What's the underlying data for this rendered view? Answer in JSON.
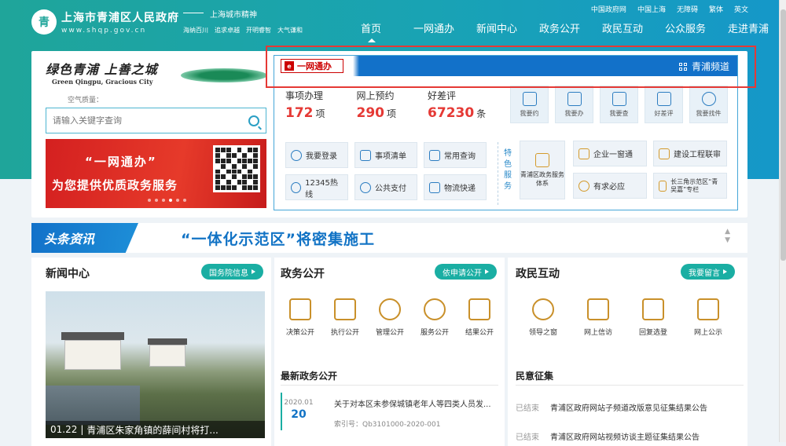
{
  "site": {
    "title": "上海市青浦区人民政府",
    "url": "www.shqp.gov.cn",
    "emblem": "青"
  },
  "spirit": {
    "title": "上海城市精神",
    "words": [
      "海纳百川",
      "追求卓越",
      "开明睿智",
      "大气谦和"
    ]
  },
  "util_links": [
    "中国政府网",
    "中国上海",
    "无障碍",
    "繁体",
    "英文"
  ],
  "nav": [
    "首页",
    "一网通办",
    "新闻中心",
    "政务公开",
    "政民互动",
    "公众服务",
    "走进青浦"
  ],
  "slogan": {
    "cn": "绿色青浦  上善之城",
    "en": "Green Qingpu, Gracious City"
  },
  "air_label": "空气质量：",
  "search": {
    "placeholder": "请输入关键字查询"
  },
  "banner": {
    "line1": "“一网通办”",
    "line2": "为您提供优质政务服务"
  },
  "ywtb": {
    "logo": "一网通办",
    "channel": "青浦频道",
    "stats": [
      {
        "label": "事项办理",
        "value": "172",
        "unit": "项"
      },
      {
        "label": "网上预约",
        "value": "290",
        "unit": "项"
      },
      {
        "label": "好差评",
        "value": "67230",
        "unit": "条"
      }
    ],
    "quick": [
      "我要约",
      "我要办",
      "我要查",
      "好差评",
      "我要找件"
    ],
    "services": [
      "我要登录",
      "事项清单",
      "常用查询",
      "12345热线",
      "公共支付",
      "物流快递"
    ],
    "feature_label": "特色服务",
    "feature_big": "青浦区政务服务体系",
    "features": [
      "企业一窗通",
      "建设工程联审",
      "有求必应",
      "长三角示范区“青吴嘉”专栏"
    ]
  },
  "headline": {
    "tag": "头条资讯",
    "text": "“一体化示范区”将密集施工"
  },
  "news_center": {
    "title": "新闻中心",
    "button": "国务院信息",
    "caption_date": "01.22",
    "caption_text": "青浦区朱家角镇的薛间村将打..."
  },
  "gov_open": {
    "title": "政务公开",
    "button": "依申请公开",
    "icons": [
      "决策公开",
      "执行公开",
      "管理公开",
      "服务公开",
      "结果公开"
    ],
    "latest_title": "最新政务公开",
    "item": {
      "year": "2020.01",
      "day": "20",
      "title": "关于对本区未参保城镇老年人等四类人员发...",
      "index": "索引号：Qb3101000-2020-001"
    }
  },
  "interaction": {
    "title": "政民互动",
    "button": "我要留言",
    "icons": [
      "领导之窗",
      "网上信访",
      "回复选登",
      "网上公示"
    ],
    "collect_title": "民意征集",
    "items": [
      {
        "status": "已结束",
        "text": "青浦区政府网站子频道改版意见征集结果公告"
      },
      {
        "status": "已结束",
        "text": "青浦区政府网站视频访谈主题征集结果公告"
      }
    ]
  },
  "colors": {
    "teal": "#1fa59a",
    "blue": "#1271c9",
    "red": "#e53935",
    "accent": "#1aaea3"
  }
}
